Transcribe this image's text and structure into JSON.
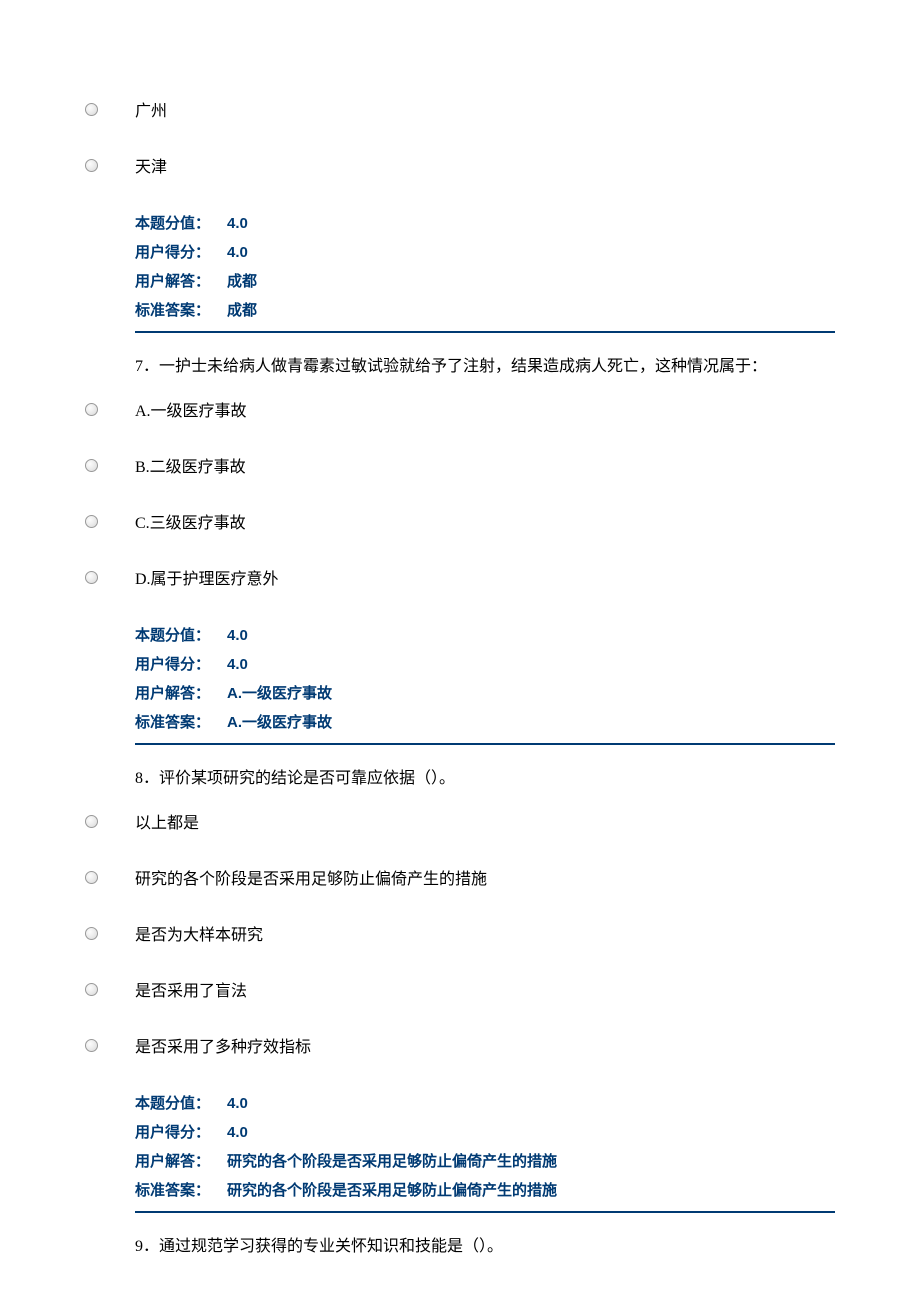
{
  "q6_partial": {
    "options": [
      "广州",
      "天津"
    ],
    "score_label": "本题分值：",
    "score_value": "4.0",
    "user_score_label": "用户得分：",
    "user_score_value": "4.0",
    "user_answer_label": "用户解答：",
    "user_answer_value": "成都",
    "std_answer_label": "标准答案：",
    "std_answer_value": "成都"
  },
  "q7": {
    "text": "7．一护士未给病人做青霉素过敏试验就给予了注射，结果造成病人死亡，这种情况属于：",
    "options": [
      "A.一级医疗事故",
      "B.二级医疗事故",
      "C.三级医疗事故",
      "D.属于护理医疗意外"
    ],
    "score_label": "本题分值：",
    "score_value": "4.0",
    "user_score_label": "用户得分：",
    "user_score_value": "4.0",
    "user_answer_label": "用户解答：",
    "user_answer_value": "A.一级医疗事故",
    "std_answer_label": "标准答案：",
    "std_answer_value": "A.一级医疗事故"
  },
  "q8": {
    "text": "8．评价某项研究的结论是否可靠应依据（）。",
    "options": [
      "以上都是",
      "研究的各个阶段是否采用足够防止偏倚产生的措施",
      "是否为大样本研究",
      "是否采用了盲法",
      "是否采用了多种疗效指标"
    ],
    "score_label": "本题分值：",
    "score_value": "4.0",
    "user_score_label": "用户得分：",
    "user_score_value": "4.0",
    "user_answer_label": "用户解答：",
    "user_answer_value": "研究的各个阶段是否采用足够防止偏倚产生的措施",
    "std_answer_label": "标准答案：",
    "std_answer_value": "研究的各个阶段是否采用足够防止偏倚产生的措施"
  },
  "q9": {
    "text": "9．通过规范学习获得的专业关怀知识和技能是（）。"
  }
}
